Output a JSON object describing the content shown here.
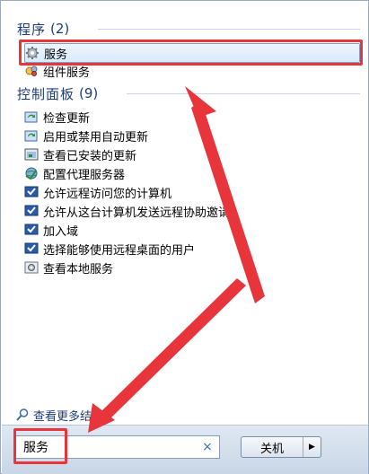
{
  "groups": {
    "programs": {
      "title": "程序",
      "count": "(2)"
    },
    "control_panel": {
      "title": "控制面板",
      "count": "(9)"
    }
  },
  "program_items": [
    {
      "label": "服务",
      "icon": "gear-icon",
      "selected": true
    },
    {
      "label": "组件服务",
      "icon": "component-services-icon",
      "selected": false
    }
  ],
  "control_panel_items": [
    {
      "label": "检查更新",
      "icon": "windows-update-icon"
    },
    {
      "label": "启用或禁用自动更新",
      "icon": "windows-update-icon"
    },
    {
      "label": "查看已安装的更新",
      "icon": "installed-updates-icon"
    },
    {
      "label": "配置代理服务器",
      "icon": "internet-options-icon"
    },
    {
      "label": "允许远程访问您的计算机",
      "icon": "remote-access-icon"
    },
    {
      "label": "允许从这台计算机发送远程协助邀请",
      "icon": "remote-assistance-icon"
    },
    {
      "label": "加入域",
      "icon": "domain-icon"
    },
    {
      "label": "选择能够使用远程桌面的用户",
      "icon": "remote-desktop-users-icon"
    },
    {
      "label": "查看本地服务",
      "icon": "local-services-icon"
    }
  ],
  "more_results": {
    "label": "查看更多结果",
    "icon": "magnifier-icon"
  },
  "search": {
    "value": "服务",
    "clear_icon": "close-icon"
  },
  "shutdown": {
    "label": "关机",
    "arrow_icon": "triangle-right-icon"
  },
  "colors": {
    "group_header": "#1e3d78",
    "annotation_red": "#e8343b",
    "selection_border": "#7da2ce"
  }
}
